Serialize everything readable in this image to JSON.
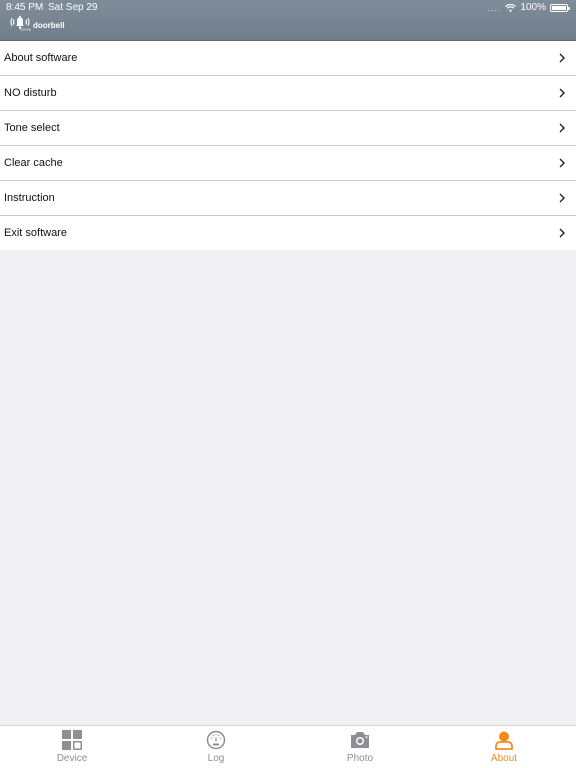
{
  "status_bar": {
    "time": "8:45 PM",
    "date": "Sat Sep 29",
    "signal": "....",
    "battery": "100%"
  },
  "header": {
    "brand_text": "doorbell"
  },
  "menu": {
    "items": [
      {
        "label": "About software"
      },
      {
        "label": "NO disturb"
      },
      {
        "label": "Tone select"
      },
      {
        "label": "Clear cache"
      },
      {
        "label": "Instruction"
      },
      {
        "label": "Exit software"
      }
    ]
  },
  "tab_bar": {
    "tabs": [
      {
        "label": "Device",
        "icon": "grid-icon"
      },
      {
        "label": "Log",
        "icon": "gauge-icon"
      },
      {
        "label": "Photo",
        "icon": "camera-icon"
      },
      {
        "label": "About",
        "icon": "person-icon"
      }
    ],
    "active": "About"
  },
  "colors": {
    "header": "#7a8693",
    "accent": "#f28c1e",
    "inactive": "#8e8e93",
    "background": "#efeff4"
  }
}
